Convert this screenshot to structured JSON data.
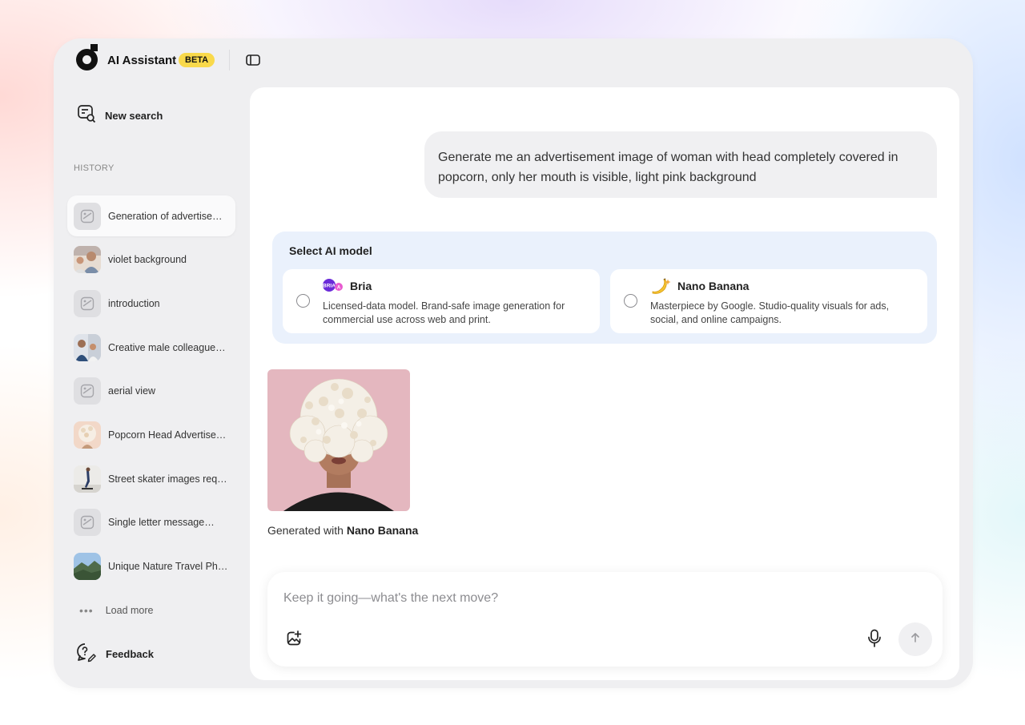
{
  "app": {
    "title": "AI Assistant",
    "beta_badge": "BETA",
    "colors": {
      "beta": "#f9d94b",
      "panel": "#efeff1",
      "model_box": "#eaf1fc"
    }
  },
  "sidebar": {
    "new_search_label": "New search",
    "history_label": "HISTORY",
    "items": [
      {
        "label": "Generation of advertise…",
        "thumb": "placeholder",
        "active": true
      },
      {
        "label": "violet background",
        "thumb": "photo"
      },
      {
        "label": "introduction",
        "thumb": "placeholder"
      },
      {
        "label": "Creative male colleague…",
        "thumb": "photo"
      },
      {
        "label": "aerial view",
        "thumb": "placeholder"
      },
      {
        "label": "Popcorn Head Advertise…",
        "thumb": "photo"
      },
      {
        "label": "Street skater images req…",
        "thumb": "photo"
      },
      {
        "label": "Single letter message…",
        "thumb": "placeholder"
      },
      {
        "label": "Unique Nature Travel Ph…",
        "thumb": "photo"
      }
    ],
    "load_more_label": "Load more",
    "feedback_label": "Feedback"
  },
  "chat": {
    "user_message": "Generate me an advertisement image of woman with head completely covered in popcorn, only her mouth is visible, light pink background",
    "model_select": {
      "title": "Select AI model",
      "options": [
        {
          "name": "Bria",
          "icon": "bria-logo-icon",
          "description": "Licensed-data model. Brand-safe image generation for commercial use across web and print."
        },
        {
          "name": "Nano Banana",
          "icon": "banana-icon",
          "description": "Masterpiece by Google. Studio-quality visuals for ads, social, and online campaigns."
        }
      ]
    },
    "generated": {
      "caption_prefix": "Generated with",
      "model_name": "Nano Banana"
    }
  },
  "composer": {
    "placeholder": "Keep it going—what's the next move?",
    "value": ""
  }
}
